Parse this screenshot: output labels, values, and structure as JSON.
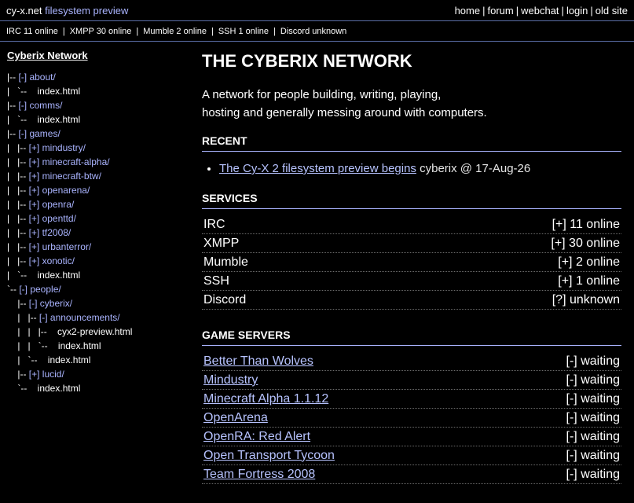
{
  "header": {
    "site": "cy-x.net",
    "subtitle": "filesystem preview",
    "nav": [
      "home",
      "forum",
      "webchat",
      "login",
      "old site"
    ]
  },
  "status": [
    "IRC 11 online",
    "XMPP 30 online",
    "Mumble 2 online",
    "SSH 1 online",
    "Discord unknown"
  ],
  "sidebar": {
    "title": "Cyberix Network",
    "tree": [
      {
        "prefix": "|-- ",
        "label": "[-] about/",
        "type": "dir"
      },
      {
        "prefix": "|   `--    ",
        "label": "index.html",
        "type": "file"
      },
      {
        "prefix": "|-- ",
        "label": "[-] comms/",
        "type": "dir"
      },
      {
        "prefix": "|   `--    ",
        "label": "index.html",
        "type": "file"
      },
      {
        "prefix": "|-- ",
        "label": "[-] games/",
        "type": "dir"
      },
      {
        "prefix": "|   |-- ",
        "label": "[+] mindustry/",
        "type": "dir"
      },
      {
        "prefix": "|   |-- ",
        "label": "[+] minecraft-alpha/",
        "type": "dir"
      },
      {
        "prefix": "|   |-- ",
        "label": "[+] minecraft-btw/",
        "type": "dir"
      },
      {
        "prefix": "|   |-- ",
        "label": "[+] openarena/",
        "type": "dir"
      },
      {
        "prefix": "|   |-- ",
        "label": "[+] openra/",
        "type": "dir"
      },
      {
        "prefix": "|   |-- ",
        "label": "[+] openttd/",
        "type": "dir"
      },
      {
        "prefix": "|   |-- ",
        "label": "[+] tf2008/",
        "type": "dir"
      },
      {
        "prefix": "|   |-- ",
        "label": "[+] urbanterror/",
        "type": "dir"
      },
      {
        "prefix": "|   |-- ",
        "label": "[+] xonotic/",
        "type": "dir"
      },
      {
        "prefix": "|   `--    ",
        "label": "index.html",
        "type": "file"
      },
      {
        "prefix": "`-- ",
        "label": "[-] people/",
        "type": "dir"
      },
      {
        "prefix": "    |-- ",
        "label": "[-] cyberix/",
        "type": "dir"
      },
      {
        "prefix": "    |   |-- ",
        "label": "[-] announcements/",
        "type": "dir"
      },
      {
        "prefix": "    |   |   |--    ",
        "label": "cyx2-preview.html",
        "type": "file"
      },
      {
        "prefix": "    |   |   `--    ",
        "label": "index.html",
        "type": "file"
      },
      {
        "prefix": "    |   `--    ",
        "label": "index.html",
        "type": "file"
      },
      {
        "prefix": "    |-- ",
        "label": "[+] lucid/",
        "type": "dir"
      },
      {
        "prefix": "    `--    ",
        "label": "index.html",
        "type": "file"
      }
    ]
  },
  "main": {
    "title": "THE CYBERIX NETWORK",
    "intro_line1": "A network for people building, writing, playing,",
    "intro_line2": "hosting and generally messing around with computers.",
    "recent_heading": "RECENT",
    "recent_items": [
      {
        "link": "The Cy-X 2 filesystem preview begins",
        "meta": " cyberix @ 17-Aug-26"
      }
    ],
    "services_heading": "SERVICES",
    "services": [
      {
        "name": "IRC",
        "status": "[+] 11 online"
      },
      {
        "name": "XMPP",
        "status": "[+] 30 online"
      },
      {
        "name": "Mumble",
        "status": "[+] 2 online"
      },
      {
        "name": "SSH",
        "status": "[+] 1 online"
      },
      {
        "name": "Discord",
        "status": "[?] unknown"
      }
    ],
    "games_heading": "GAME SERVERS",
    "games": [
      {
        "name": "Better Than Wolves",
        "status": "[-] waiting"
      },
      {
        "name": "Mindustry",
        "status": "[-] waiting"
      },
      {
        "name": "Minecraft Alpha 1.1.12",
        "status": "[-] waiting"
      },
      {
        "name": "OpenArena",
        "status": "[-] waiting"
      },
      {
        "name": "OpenRA: Red Alert",
        "status": "[-] waiting"
      },
      {
        "name": "Open Transport Tycoon",
        "status": "[-] waiting"
      },
      {
        "name": "Team Fortress 2008",
        "status": "[-] waiting"
      }
    ]
  }
}
